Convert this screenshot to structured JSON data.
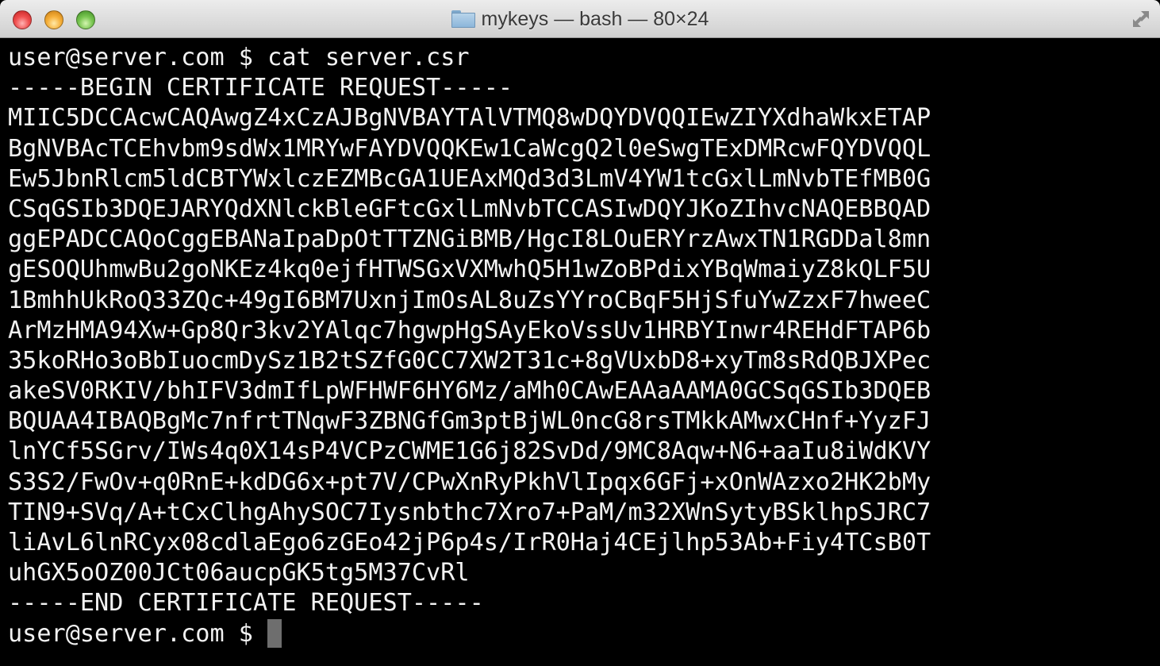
{
  "window": {
    "title": "mykeys — bash — 80×24",
    "title_icon": "folder-icon",
    "buttons": [
      "close",
      "minimize",
      "zoom"
    ],
    "fullscreen_icon": "fullscreen-arrows-icon"
  },
  "terminal": {
    "command_line": "user@server.com $ cat server.csr",
    "begin_marker": "-----BEGIN CERTIFICATE REQUEST-----",
    "body_lines": [
      "MIIC5DCCAcwCAQAwgZ4xCzAJBgNVBAYTAlVTMQ8wDQYDVQQIEwZIYXdhaWkxETAP",
      "BgNVBAcTCEhvbm9sdWx1MRYwFAYDVQQKEw1CaWcgQ2l0eSwgTExDMRcwFQYDVQQL",
      "Ew5JbnRlcm5ldCBTYWxlczEZMBcGA1UEAxMQd3d3LmV4YW1tcGxlLmNvbTEfMB0G",
      "CSqGSIb3DQEJARYQdXNlckBleGFtcGxlLmNvbTCCASIwDQYJKoZIhvcNAQEBBQAD",
      "ggEPADCCAQoCggEBANaIpaDpOtTTZNGiBMB/HgcI8LOuERYrzAwxTN1RGDDal8mn",
      "gESOQUhmwBu2goNKEz4kq0ejfHTWSGxVXMwhQ5H1wZoBPdixYBqWmaiyZ8kQLF5U",
      "1BmhhUkRoQ33ZQc+49gI6BM7UxnjImOsAL8uZsYYroCBqF5HjSfuYwZzxF7hweeC",
      "ArMzHMA94Xw+Gp8Qr3kv2YAlqc7hgwpHgSAyEkoVssUv1HRBYInwr4REHdFTAP6b",
      "35koRHo3oBbIuocmDySz1B2tSZfG0CC7XW2T31c+8gVUxbD8+xyTm8sRdQBJXPec",
      "akeSV0RKIV/bhIFV3dmIfLpWFHWF6HY6Mz/aMh0CAwEAAaAAMA0GCSqGSIb3DQEB",
      "BQUAA4IBAQBgMc7nfrtTNqwF3ZBNGfGm3ptBjWL0ncG8rsTMkkAMwxCHnf+YyzFJ",
      "lnYCf5SGrv/IWs4q0X14sP4VCPzCWME1G6j82SvDd/9MC8Aqw+N6+aaIu8iWdKVY",
      "S3S2/FwOv+q0RnE+kdDG6x+pt7V/CPwXnRyPkhVlIpqx6GFj+xOnWAzxo2HK2bMy",
      "TIN9+SVq/A+tCxClhgAhySOC7Iysnbthc7Xro7+PaM/m32XWnSytyBSklhpSJRC7",
      "liAvL6lnRCyx08cdlaEgo6zGEo42jP6p4s/IrR0Haj4CEjlhp53Ab+Fiy4TCsB0T",
      "uhGX5oOZ00JCt06aucpGK5tg5M37CvRl"
    ],
    "end_marker": "-----END CERTIFICATE REQUEST-----",
    "prompt": "user@server.com $ "
  }
}
